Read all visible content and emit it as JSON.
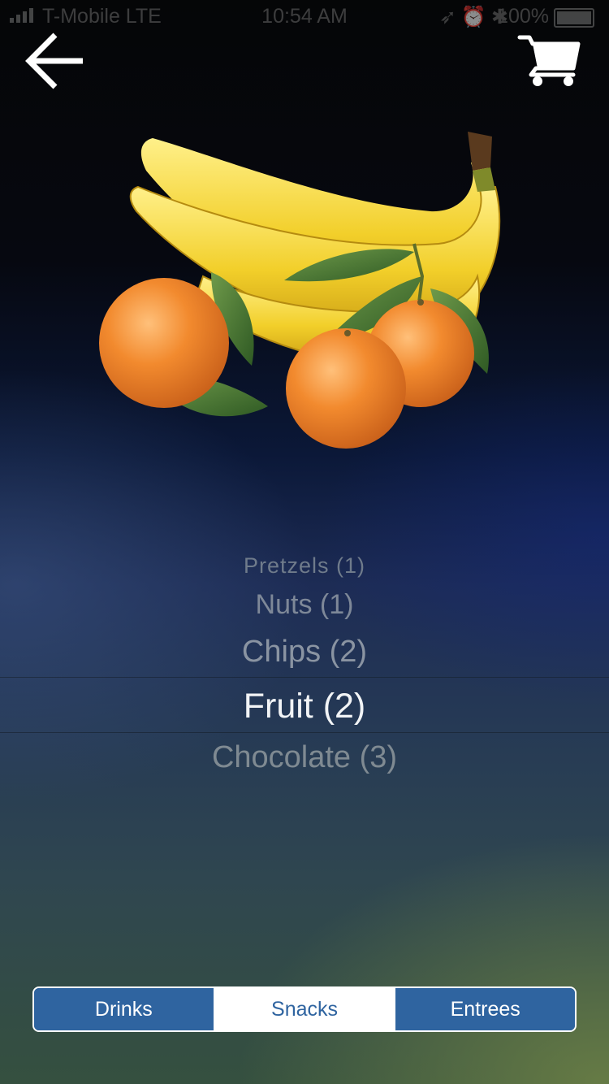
{
  "status_bar": {
    "carrier": "T-Mobile  LTE",
    "time": "10:54 AM",
    "battery": "100%"
  },
  "nav": {
    "back_icon": "arrow-left-icon",
    "cart_icon": "shopping-cart-icon"
  },
  "picker": {
    "items": [
      {
        "label": "Pretzels (1)"
      },
      {
        "label": "Nuts (1)"
      },
      {
        "label": "Chips (2)"
      },
      {
        "label": "Fruit (2)"
      },
      {
        "label": "Chocolate (3)"
      }
    ],
    "selected": "Fruit (2)"
  },
  "segments": {
    "items": [
      {
        "label": "Drinks"
      },
      {
        "label": "Snacks"
      },
      {
        "label": "Entrees"
      }
    ],
    "selected": "Snacks"
  },
  "colors": {
    "segment_blue": "#2f64a0",
    "banana_yellow": "#f2d02c",
    "orange": "#ef8a2c"
  }
}
